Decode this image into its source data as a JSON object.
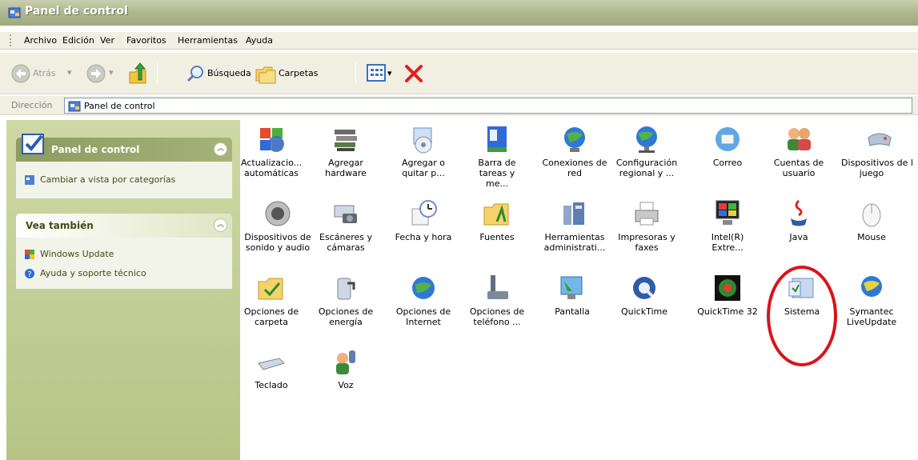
{
  "window": {
    "title": "Panel de control"
  },
  "menu": [
    "Archivo",
    "Edición",
    "Ver",
    "Favoritos",
    "Herramientas",
    "Ayuda"
  ],
  "toolbar": {
    "back": "Atrás",
    "search": "Búsqueda",
    "folders": "Carpetas"
  },
  "address": {
    "label": "Dirección",
    "value": "Panel de control"
  },
  "sidebar": {
    "panel1": {
      "title": "Panel de control",
      "task": "Cambiar a vista por categorías"
    },
    "panel2": {
      "title": "Vea también",
      "links": [
        "Windows Update",
        "Ayuda y soporte técnico"
      ]
    }
  },
  "items": [
    {
      "l1": "Actualizacio...",
      "l2": "automáticas",
      "icon": "automatic-updates-icon"
    },
    {
      "l1": "Agregar",
      "l2": "hardware",
      "icon": "add-hardware-icon"
    },
    {
      "l1": "Agregar o",
      "l2": "quitar p...",
      "icon": "add-remove-programs-icon"
    },
    {
      "l1": "Barra de",
      "l2": "tareas y me...",
      "icon": "taskbar-icon"
    },
    {
      "l1": "Conexiones de",
      "l2": "red",
      "icon": "network-connections-icon"
    },
    {
      "l1": "Configuración",
      "l2": "regional y ...",
      "icon": "regional-settings-icon"
    },
    {
      "l1": "Correo",
      "l2": "",
      "icon": "mail-icon"
    },
    {
      "l1": "Cuentas de",
      "l2": "usuario",
      "icon": "user-accounts-icon"
    },
    {
      "l1": "Dispositivos de l",
      "l2": "juego",
      "icon": "game-controllers-icon"
    },
    {
      "l1": "Dispositivos de",
      "l2": "sonido y audio",
      "icon": "sound-icon"
    },
    {
      "l1": "Escáneres y",
      "l2": "cámaras",
      "icon": "scanners-cameras-icon"
    },
    {
      "l1": "Fecha y hora",
      "l2": "",
      "icon": "date-time-icon"
    },
    {
      "l1": "Fuentes",
      "l2": "",
      "icon": "fonts-folder-icon"
    },
    {
      "l1": "Herramientas",
      "l2": "administrati...",
      "icon": "admin-tools-icon"
    },
    {
      "l1": "Impresoras y",
      "l2": "faxes",
      "icon": "printers-icon"
    },
    {
      "l1": "Intel(R)",
      "l2": "Extre...",
      "icon": "intel-graphics-icon"
    },
    {
      "l1": "Java",
      "l2": "",
      "icon": "java-icon"
    },
    {
      "l1": "Mouse",
      "l2": "",
      "icon": "mouse-icon"
    },
    {
      "l1": "Opciones de",
      "l2": "carpeta",
      "icon": "folder-options-icon"
    },
    {
      "l1": "Opciones de",
      "l2": "energía",
      "icon": "power-options-icon"
    },
    {
      "l1": "Opciones de",
      "l2": "Internet",
      "icon": "internet-options-icon"
    },
    {
      "l1": "Opciones de",
      "l2": "teléfono ...",
      "icon": "phone-modem-icon"
    },
    {
      "l1": "Pantalla",
      "l2": "",
      "icon": "display-icon"
    },
    {
      "l1": "QuickTime",
      "l2": "",
      "icon": "quicktime-icon"
    },
    {
      "l1": "QuickTime 32",
      "l2": "",
      "icon": "quicktime32-icon"
    },
    {
      "l1": "Sistema",
      "l2": "",
      "icon": "system-icon"
    },
    {
      "l1": "Symantec",
      "l2": "LiveUpdate",
      "icon": "liveupdate-icon"
    },
    {
      "l1": "Teclado",
      "l2": "",
      "icon": "keyboard-icon"
    },
    {
      "l1": "Voz",
      "l2": "",
      "icon": "speech-icon"
    }
  ],
  "colors": {
    "highlight": "#d8141b",
    "sidebar": "#c4ce94",
    "titlebar": "#aeb78e"
  }
}
